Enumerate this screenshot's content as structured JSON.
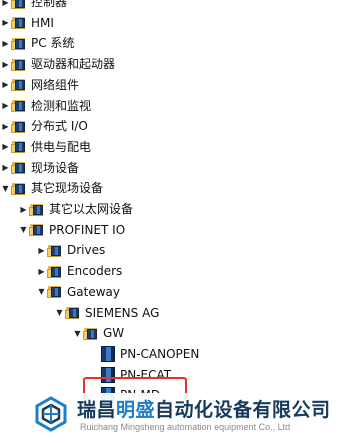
{
  "tree": [
    {
      "label": "控制器",
      "level": 0,
      "arrow": "collapsed",
      "icon": "folder-icon"
    },
    {
      "label": "HMI",
      "level": 0,
      "arrow": "collapsed",
      "icon": "folder-icon"
    },
    {
      "label": "PC 系统",
      "level": 0,
      "arrow": "collapsed",
      "icon": "folder-icon"
    },
    {
      "label": "驱动器和起动器",
      "level": 0,
      "arrow": "collapsed",
      "icon": "folder-icon"
    },
    {
      "label": "网络组件",
      "level": 0,
      "arrow": "collapsed",
      "icon": "folder-icon"
    },
    {
      "label": "检测和监视",
      "level": 0,
      "arrow": "collapsed",
      "icon": "folder-icon"
    },
    {
      "label": "分布式 I/O",
      "level": 0,
      "arrow": "collapsed",
      "icon": "folder-icon"
    },
    {
      "label": "供电与配电",
      "level": 0,
      "arrow": "collapsed",
      "icon": "folder-icon"
    },
    {
      "label": "现场设备",
      "level": 0,
      "arrow": "collapsed",
      "icon": "folder-icon"
    },
    {
      "label": "其它现场设备",
      "level": 0,
      "arrow": "expanded",
      "icon": "folder-icon"
    },
    {
      "label": "其它以太网设备",
      "level": 1,
      "arrow": "collapsed",
      "icon": "folder-icon"
    },
    {
      "label": "PROFINET IO",
      "level": 1,
      "arrow": "expanded",
      "icon": "folder-icon"
    },
    {
      "label": "Drives",
      "level": 2,
      "arrow": "collapsed",
      "icon": "folder-icon"
    },
    {
      "label": "Encoders",
      "level": 2,
      "arrow": "collapsed",
      "icon": "folder-icon"
    },
    {
      "label": "Gateway",
      "level": 2,
      "arrow": "expanded",
      "icon": "folder-icon"
    },
    {
      "label": "SIEMENS AG",
      "level": 3,
      "arrow": "expanded",
      "icon": "folder-icon"
    },
    {
      "label": "GW",
      "level": 4,
      "arrow": "expanded",
      "icon": "folder-icon"
    },
    {
      "label": "PN-CANOPEN",
      "level": 5,
      "arrow": "none",
      "icon": "device-icon"
    },
    {
      "label": "PN-ECAT",
      "level": 5,
      "arrow": "none",
      "icon": "device-icon"
    },
    {
      "label": "PN-MD",
      "level": 5,
      "arrow": "none",
      "icon": "device-icon"
    }
  ],
  "glyphs": {
    "collapsed": "▶",
    "expanded": "▼",
    "none": ""
  },
  "highlight": {
    "target": "PN-MD",
    "color": "#e8312a"
  },
  "watermark": {
    "title_part1": "瑞昌",
    "title_accent": "明盛",
    "title_part2": "自动化设备有限公司",
    "subtitle": "Ruichang Mingsheng automation equipment Co., Ltd"
  }
}
